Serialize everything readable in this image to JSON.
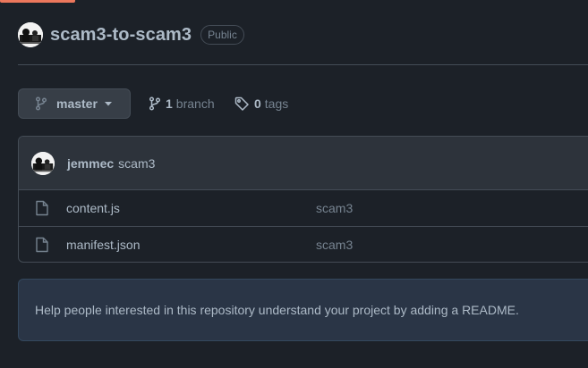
{
  "repo": {
    "name": "scam3-to-scam3",
    "visibility": "Public"
  },
  "branch_selector": {
    "label": "master",
    "icon": "git-branch-icon"
  },
  "branches": {
    "count": "1",
    "word": "branch"
  },
  "tags": {
    "count": "0",
    "word": "tags"
  },
  "latest_commit": {
    "author": "jemmec",
    "message": "scam3"
  },
  "files": [
    {
      "name": "content.js",
      "commit": "scam3",
      "icon": "file-icon"
    },
    {
      "name": "manifest.json",
      "commit": "scam3",
      "icon": "file-icon"
    }
  ],
  "readme_prompt": "Help people interested in this repository understand your project by adding a README.",
  "colors": {
    "background": "#1c2128",
    "accent_underline": "#ec775c",
    "border": "#444c56",
    "banner": "#2a3546"
  }
}
